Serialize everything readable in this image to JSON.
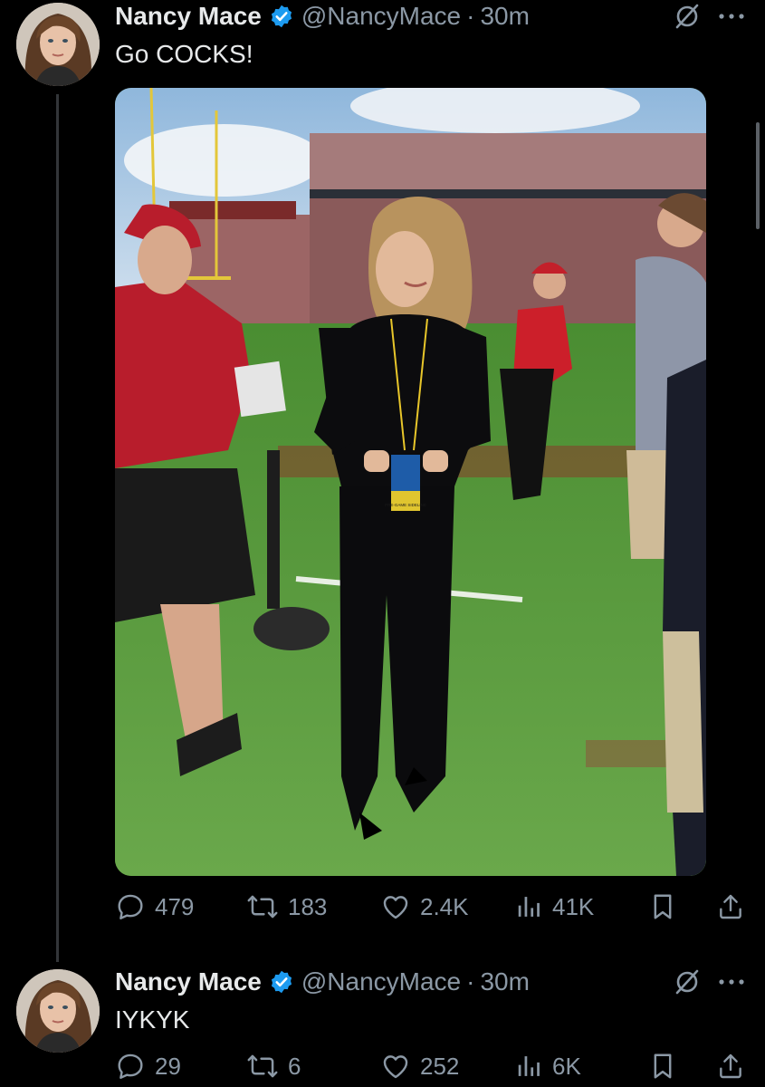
{
  "tweets": [
    {
      "display_name": "Nancy Mace",
      "handle": "@NancyMace",
      "separator": "·",
      "time": "30m",
      "text": "Go COCKS!",
      "media": {
        "badge_text": "PRE-GAME SIDELINE"
      },
      "stats": {
        "replies": "479",
        "reposts": "183",
        "likes": "2.4K",
        "views": "41K"
      }
    },
    {
      "display_name": "Nancy Mace",
      "handle": "@NancyMace",
      "separator": "·",
      "time": "30m",
      "text": "IYKYK",
      "stats": {
        "replies": "29",
        "reposts": "6",
        "likes": "252",
        "views": "6K"
      }
    }
  ],
  "colors": {
    "background": "#000000",
    "text": "#e7e9ea",
    "secondary": "#8b98a5",
    "verified": "#1d9bf0",
    "thread_line": "#333639"
  },
  "icons": [
    "verified-badge-icon",
    "grok-slash-icon",
    "more-icon",
    "reply-icon",
    "repost-icon",
    "like-icon",
    "views-icon",
    "bookmark-icon",
    "share-icon"
  ]
}
